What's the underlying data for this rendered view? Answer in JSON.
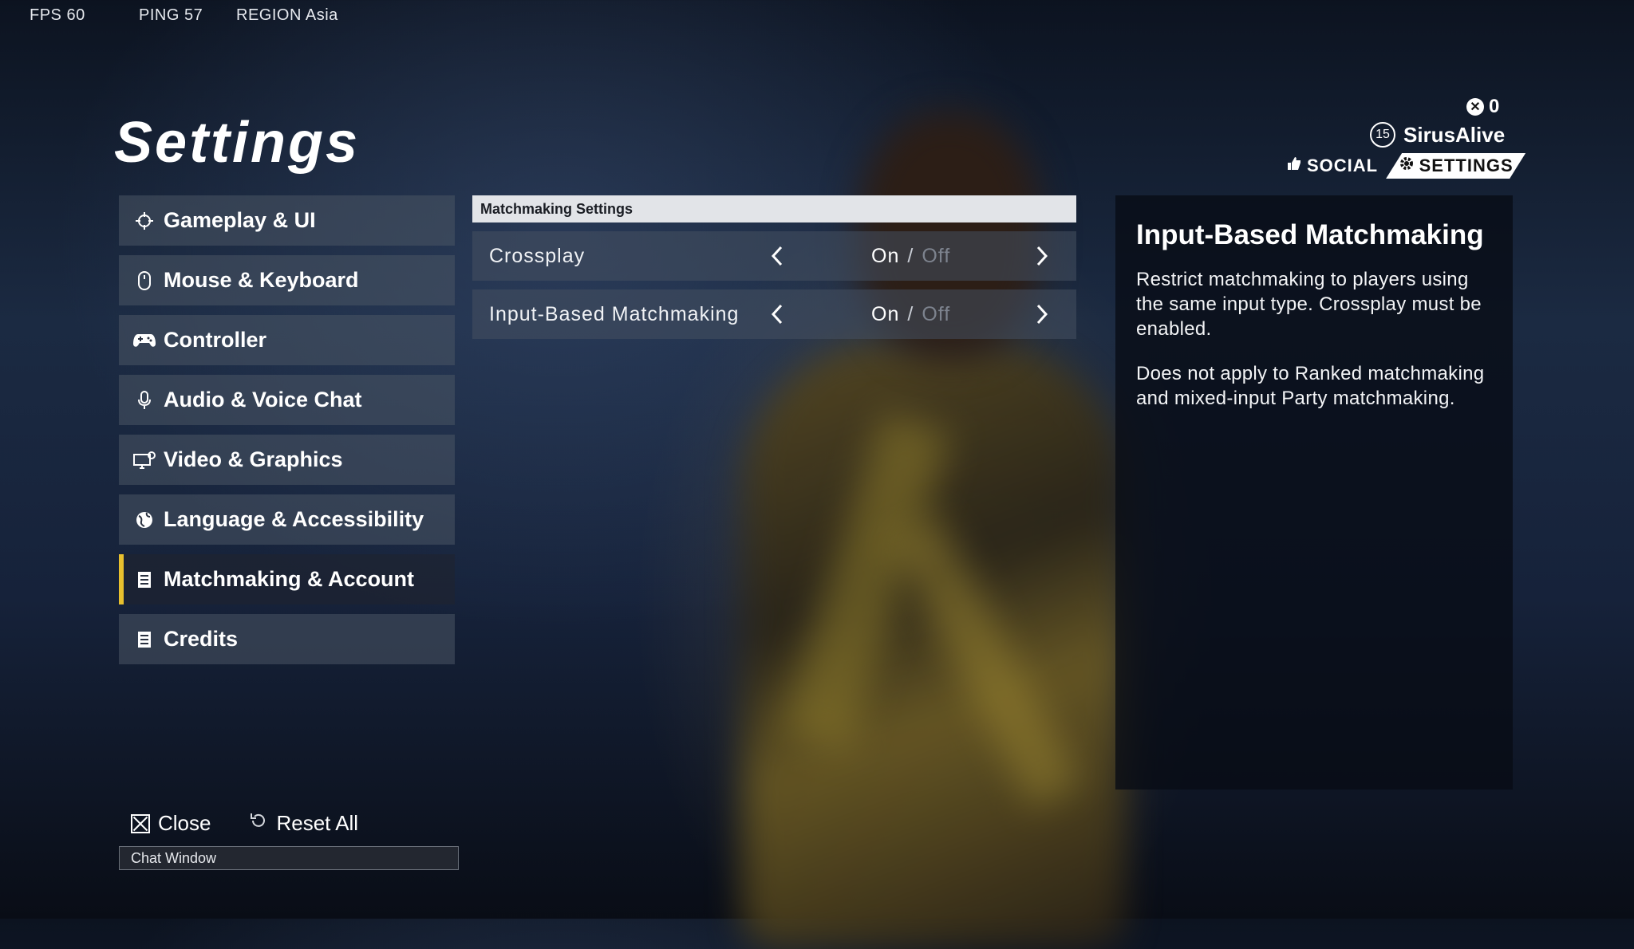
{
  "hud": {
    "fps": "FPS 60",
    "ping": "PING 57",
    "region": "REGION Asia"
  },
  "page_title": "Settings",
  "profile": {
    "currency": "0",
    "level": "15",
    "username": "SirusAlive"
  },
  "top_nav": {
    "social": "SOCIAL",
    "settings": "SETTINGS"
  },
  "sidebar": {
    "items": [
      {
        "label": "Gameplay & UI",
        "icon": "crosshair-icon"
      },
      {
        "label": "Mouse & Keyboard",
        "icon": "mouse-icon"
      },
      {
        "label": "Controller",
        "icon": "gamepad-icon"
      },
      {
        "label": "Audio & Voice Chat",
        "icon": "microphone-icon"
      },
      {
        "label": "Video & Graphics",
        "icon": "monitor-icon"
      },
      {
        "label": "Language & Accessibility",
        "icon": "globe-icon"
      },
      {
        "label": "Matchmaking & Account",
        "icon": "document-icon",
        "active": true
      },
      {
        "label": "Credits",
        "icon": "document-icon"
      }
    ]
  },
  "panel": {
    "header": "Matchmaking Settings",
    "settings": [
      {
        "label": "Crossplay",
        "on": "On",
        "sep": "/",
        "off": "Off",
        "selected": "On"
      },
      {
        "label": "Input-Based Matchmaking",
        "on": "On",
        "sep": "/",
        "off": "Off",
        "selected": "On"
      }
    ]
  },
  "description": {
    "title": "Input-Based Matchmaking",
    "paragraphs": [
      "Restrict matchmaking to players using the same input type. Crossplay must be enabled.",
      "Does not apply to Ranked matchmaking and mixed-input Party matchmaking."
    ]
  },
  "actions": {
    "close": "Close",
    "reset": "Reset All"
  },
  "chat_window": "Chat Window",
  "colors": {
    "accent": "#e8c02e",
    "off_text": "#7d838e"
  }
}
